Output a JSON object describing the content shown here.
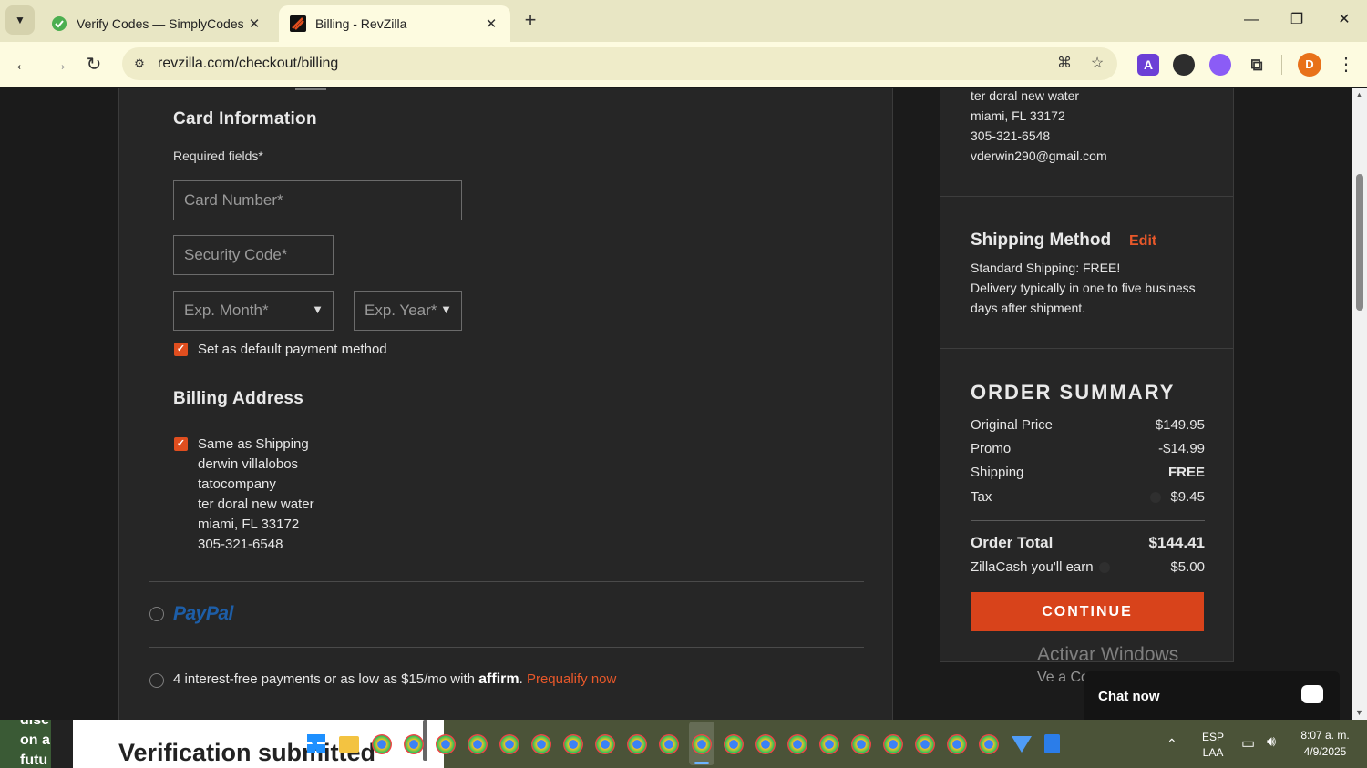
{
  "browser": {
    "tabs": [
      {
        "title": "Verify Codes — SimplyCodes",
        "active": false
      },
      {
        "title": "Billing - RevZilla",
        "active": true
      }
    ],
    "url": "revzilla.com/checkout/billing",
    "profile_initial": "D",
    "extension_letter": "A"
  },
  "card_info": {
    "title": "Card Information",
    "required_note": "Required fields*",
    "card_number_placeholder": "Card Number*",
    "security_code_placeholder": "Security Code*",
    "exp_month_placeholder": "Exp. Month*",
    "exp_year_placeholder": "Exp. Year*",
    "default_payment_label": "Set as default payment method",
    "default_payment_checked": true
  },
  "billing": {
    "title": "Billing Address",
    "same_as_shipping_label": "Same as Shipping",
    "same_as_shipping_checked": true,
    "address": [
      "derwin villalobos",
      "tatocompany",
      "ter doral new water",
      "miami, FL 33172",
      "305-321-6548"
    ]
  },
  "payment_options": {
    "paypal": "PayPal",
    "affirm_text": "4 interest-free payments or as low as $15/mo with",
    "affirm_logo": "affirm",
    "affirm_dot": ".",
    "affirm_link": "Prequalify now"
  },
  "sidebar": {
    "contact": [
      "ter doral new water",
      "miami, FL 33172",
      "305-321-6548",
      "vderwin290@gmail.com"
    ],
    "shipping_method": {
      "title": "Shipping Method",
      "edit_label": "Edit",
      "lines": [
        "Standard Shipping: FREE!",
        "Delivery typically in one to five business",
        "days after shipment."
      ]
    },
    "summary": {
      "title": "ORDER SUMMARY",
      "rows": [
        {
          "label": "Original Price",
          "value": "$149.95"
        },
        {
          "label": "Promo",
          "value": "-$14.99"
        },
        {
          "label": "Shipping",
          "value": "FREE"
        },
        {
          "label": "Tax",
          "value": "$9.45"
        }
      ],
      "total_label": "Order Total",
      "total_value": "$144.41",
      "zillacash_label": "ZillaCash you'll earn",
      "zillacash_value": "$5.00",
      "continue_label": "CONTINUE"
    }
  },
  "overlays": {
    "watermark_title": "Activar Windows",
    "watermark_sub": "Ve a Configuración para activar Windows.",
    "chat_label": "Chat now",
    "notification_text": "Verification submitted",
    "left_peek": [
      "disc",
      "on a",
      "futu"
    ]
  },
  "taskbar": {
    "lang_top": "ESP",
    "lang_bottom": "LAA",
    "time": "8:07 a. m.",
    "date": "4/9/2025"
  },
  "colors": {
    "accent": "#e04e1f",
    "button": "#d8431b",
    "paypal": "#1d5ea8",
    "page_bg": "#262626"
  }
}
